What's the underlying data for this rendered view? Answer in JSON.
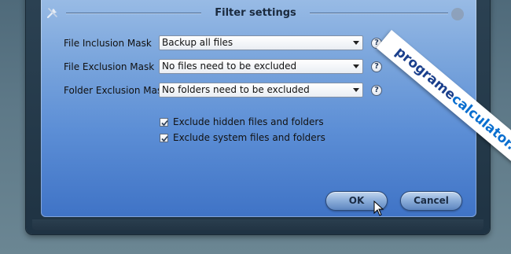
{
  "dialog": {
    "title": "Filter settings"
  },
  "fields": [
    {
      "label": "File Inclusion Mask",
      "value": "Backup all files"
    },
    {
      "label": "File Exclusion Mask",
      "value": "No files need to be excluded"
    },
    {
      "label": "Folder Exclusion Mask",
      "value": "No folders need to be excluded"
    }
  ],
  "help_glyph": "?",
  "checkboxes": [
    {
      "label": "Exclude hidden files and folders",
      "checked": true
    },
    {
      "label": "Exclude system files and folders",
      "checked": true
    }
  ],
  "buttons": {
    "ok": "OK",
    "cancel": "Cancel"
  },
  "watermark": {
    "part1": "programe",
    "part2": "calculator.ro"
  },
  "icons": {
    "tools": "tools-icon",
    "settings": "gear-icon"
  }
}
